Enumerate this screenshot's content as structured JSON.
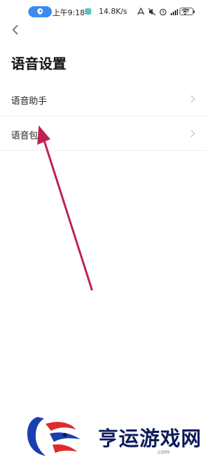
{
  "status_bar": {
    "time": "上午9:18",
    "net_speed": "14.8K/s",
    "battery": "97"
  },
  "header": {
    "title": "语音设置"
  },
  "settings": {
    "items": [
      {
        "label": "语音助手"
      },
      {
        "label": "语音包"
      }
    ]
  },
  "watermark": {
    "text": "亨运游戏网",
    "sub": ".com"
  },
  "colors": {
    "accent": "#3b8bf0",
    "annotation_arrow": "#c0214f",
    "watermark_text": "#0d1b5c"
  },
  "icons": [
    "location-pin-icon",
    "app-notification-icon",
    "network-icon",
    "mute-icon",
    "alarm-icon",
    "signal-icon",
    "wifi-icon",
    "battery-icon",
    "back-arrow-icon",
    "chevron-right-icon"
  ]
}
